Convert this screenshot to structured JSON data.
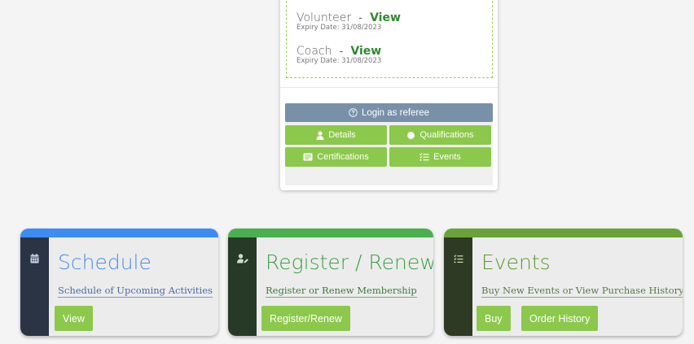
{
  "profile": {
    "roles": [
      {
        "name": "Volunteer",
        "separator": "-",
        "link_label": "View",
        "expiry": "Expiry Date: 31/08/2023"
      },
      {
        "name": "Coach",
        "separator": "-",
        "link_label": "View",
        "expiry": "Expiry Date: 31/08/2023"
      }
    ],
    "buttons": {
      "referee": {
        "label": "Login as referee",
        "icon": "question-circle-icon"
      },
      "details": {
        "label": "Details",
        "icon": "user-icon"
      },
      "qualifications": {
        "label": "Qualifications",
        "icon": "badge-icon"
      },
      "certifications": {
        "label": "Certifications",
        "icon": "certificate-icon"
      },
      "events": {
        "label": "Events",
        "icon": "checklist-icon"
      }
    }
  },
  "tiles": {
    "schedule": {
      "icon": "calendar-icon",
      "title": "Schedule",
      "subtitle": "Schedule of Upcoming Activities",
      "buttons": [
        "View"
      ]
    },
    "register": {
      "icon": "user-edit-icon",
      "title": "Register / Renew",
      "subtitle": "Register or Renew Membership",
      "buttons": [
        "Register/Renew"
      ]
    },
    "events": {
      "icon": "checklist-icon",
      "title": "Events",
      "subtitle": "Buy New Events or View Purchase History",
      "buttons": [
        "Buy",
        "Order History"
      ]
    }
  },
  "colors": {
    "accent_green": "#8cc84b",
    "referee_button": "#7890a8",
    "schedule_bar": "#3d8cf5",
    "register_bar": "#4caf4f",
    "events_bar": "#6aa23a",
    "link_green": "#2e8a2e"
  }
}
